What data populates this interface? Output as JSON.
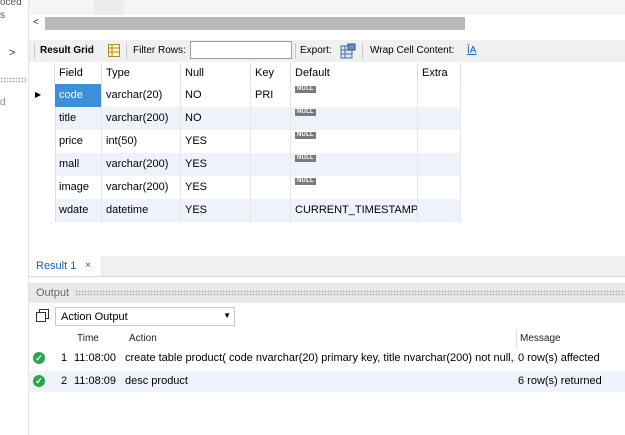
{
  "left": {
    "frag_top": "oced",
    "frag_small": "s",
    "frag_mid": "d",
    "chevron": ">"
  },
  "scroll": {
    "left_arrow": "<"
  },
  "toolbar": {
    "result_grid": "Result Grid",
    "filter_rows_label": "Filter Rows:",
    "filter_rows_value": "",
    "export_label": "Export:",
    "wrap_label": "Wrap Cell Content:",
    "wrap_icon": "ĪA"
  },
  "grid": {
    "columns": [
      "Field",
      "Type",
      "Null",
      "Key",
      "Default",
      "Extra"
    ],
    "rows": [
      {
        "field": "code",
        "type": "varchar(20)",
        "null": "NO",
        "key": "PRI",
        "default": "NULL",
        "extra": ""
      },
      {
        "field": "title",
        "type": "varchar(200)",
        "null": "NO",
        "key": "",
        "default": "NULL",
        "extra": ""
      },
      {
        "field": "price",
        "type": "int(50)",
        "null": "YES",
        "key": "",
        "default": "NULL",
        "extra": ""
      },
      {
        "field": "mall",
        "type": "varchar(200)",
        "null": "YES",
        "key": "",
        "default": "NULL",
        "extra": ""
      },
      {
        "field": "image",
        "type": "varchar(200)",
        "null": "YES",
        "key": "",
        "default": "NULL",
        "extra": ""
      },
      {
        "field": "wdate",
        "type": "datetime",
        "null": "YES",
        "key": "",
        "default": "CURRENT_TIMESTAMP",
        "extra": ""
      }
    ]
  },
  "result_tab": {
    "label": "Result 1",
    "close": "×"
  },
  "output": {
    "title": "Output",
    "dropdown_value": "Action Output",
    "columns": {
      "time": "Time",
      "action": "Action",
      "message": "Message"
    },
    "rows": [
      {
        "num": "1",
        "time": "11:08:00",
        "action": "create table product( code nvarchar(20) primary key, title nvarchar(200) not null,...",
        "message": "0 row(s) affected"
      },
      {
        "num": "2",
        "time": "11:08:09",
        "action": "desc product",
        "message": "6 row(s) returned"
      }
    ]
  },
  "colors": {
    "selected_cell": "#3d8fd9",
    "alt_row": "#eef3fb",
    "link_blue": "#1a5fb4",
    "ok_green": "#2ea44f"
  }
}
